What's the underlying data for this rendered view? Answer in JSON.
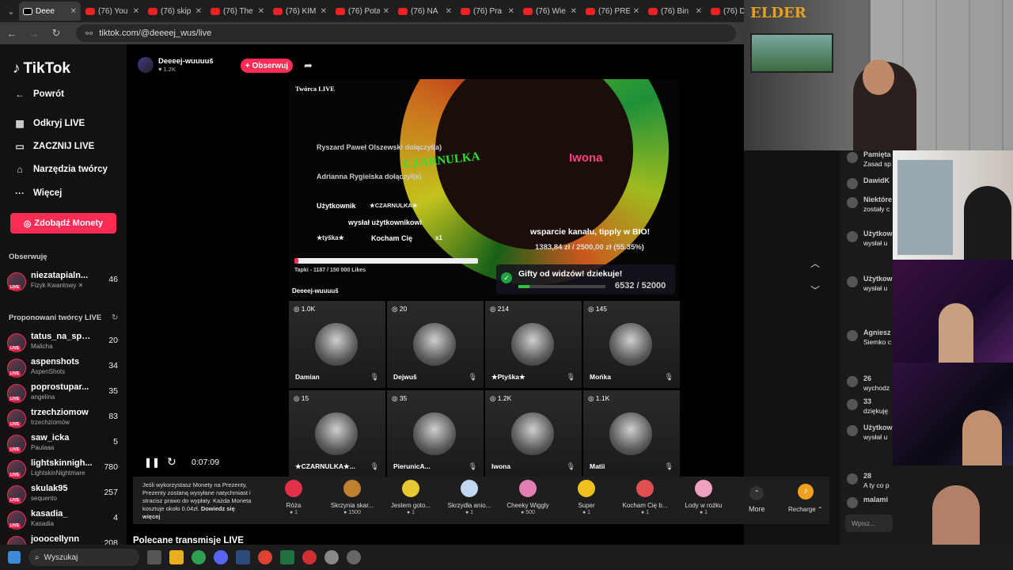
{
  "browser": {
    "tabs": [
      {
        "title": "Deee",
        "active": true
      },
      {
        "title": "(76) You"
      },
      {
        "title": "(76) skip"
      },
      {
        "title": "(76) The"
      },
      {
        "title": "(76) KIM"
      },
      {
        "title": "(76) Pota"
      },
      {
        "title": "(76) NA"
      },
      {
        "title": "(76) Pra"
      },
      {
        "title": "(76) Wie"
      },
      {
        "title": "(76) PRE"
      },
      {
        "title": "(76) Bin"
      },
      {
        "title": "(76) D"
      }
    ],
    "url": "tiktok.com/@deeeej_wus/live"
  },
  "sidebar": {
    "logo": "TikTok",
    "nav": [
      {
        "label": "Powrót",
        "icon": "back-arrow-icon",
        "glyph": "←"
      },
      {
        "label": "Odkryj LIVE",
        "icon": "calendar-icon",
        "glyph": "▦"
      },
      {
        "label": "ZACZNIJ LIVE",
        "icon": "camera-icon",
        "glyph": "▭"
      },
      {
        "label": "Narzędzia twórcy",
        "icon": "home-icon",
        "glyph": "⌂"
      },
      {
        "label": "Więcej",
        "icon": "more-dots-icon",
        "glyph": "···"
      }
    ],
    "coins_button": "Zdobądź Monety",
    "following_title": "Obserwuję",
    "following": [
      {
        "name": "niezatapialn...",
        "sub": "Fizyk Kwantowy ✕",
        "count": "46"
      }
    ],
    "suggested_title": "Proponowani twórcy LIVE",
    "suggested": [
      {
        "name": "tatus_na_spo...",
        "sub": "Malicha",
        "count": "20"
      },
      {
        "name": "aspenshots",
        "sub": "AspenShots",
        "count": "34"
      },
      {
        "name": "poprostupar...",
        "sub": "angelina",
        "count": "35"
      },
      {
        "name": "trzechziomow",
        "sub": "trzechziomów",
        "count": "83"
      },
      {
        "name": "saw_icka",
        "sub": "Paulaaa",
        "count": "5"
      },
      {
        "name": "lightskinnigh...",
        "sub": "LightskinNightmare",
        "count": "780"
      },
      {
        "name": "skulak95",
        "sub": "sequento",
        "count": "257"
      },
      {
        "name": "kasadia_",
        "sub": "Kasadia",
        "count": "4"
      },
      {
        "name": "jooocellynn",
        "sub": "",
        "count": "208"
      }
    ]
  },
  "host": {
    "name": "Deeeej-wuuuuš",
    "followers": "1.2K",
    "follow_label": "+ Obserwuj"
  },
  "stream": {
    "creator_tag": "Twórca LIVE",
    "joins": [
      {
        "name": "Ryszard Paweł Olszewski",
        "action": "dołączył(a)"
      },
      {
        "name": "Adrianna Rygielska",
        "action": "dołączył(a)"
      }
    ],
    "banner": "CZARNULKA",
    "gift_user": "Użytkownik",
    "gift_from": "★CZARNULKA★",
    "gift_action": "wysłał użytkownikowi",
    "gift_target": "★tyška★",
    "gift_msg": "Kocham Cię",
    "gift_mult": "x1",
    "iwona": "Iwona",
    "support_text": "wsparcie kanału, tipply w BIO!",
    "money": "1383,84 zł / 2500,00 zł (55.35%)",
    "likes_text": "Tapki - 1187 / 150 000 Likes",
    "likes_progress": 0.0079,
    "goal_text": "Gifty od widzów! dziekuje!",
    "goal_current": "6532",
    "goal_total": "52000",
    "goal_progress": 0.1256,
    "host_label": "Deeeej-wuuuuš"
  },
  "guests": [
    {
      "count": "1.0K",
      "name": "Damian"
    },
    {
      "count": "20",
      "name": "Dejwuš"
    },
    {
      "count": "214",
      "name": "★Ptyška★"
    },
    {
      "count": "145",
      "name": "Mońka"
    },
    {
      "count": "15",
      "name": "★CZARNULKA★..."
    },
    {
      "count": "35",
      "name": "PierunicA..."
    },
    {
      "count": "1.2K",
      "name": "Iwona"
    },
    {
      "count": "1.1K",
      "name": "Matii"
    }
  ],
  "player": {
    "time": "0:07:09"
  },
  "gifts": {
    "info": "Jeśli wykorzystasz Monety na Prezenty, Prezenty zostaną wysyłane natychmiast i stracisz prawo do wypłaty. Każda Moneta kosztuje około 0.04zł.",
    "info_link": "Dowiedz się więcej",
    "items": [
      {
        "label": "Róża",
        "price": "1",
        "color": "#e0304a"
      },
      {
        "label": "Skrzynia skar...",
        "price": "1500",
        "color": "#c08030"
      },
      {
        "label": "Jestem goto...",
        "price": "1",
        "color": "#e8c830"
      },
      {
        "label": "Skrzydła anio...",
        "price": "1",
        "color": "#c0d8f0"
      },
      {
        "label": "Cheeky Wiggly",
        "price": "500",
        "color": "#e080b0"
      },
      {
        "label": "Super",
        "price": "1",
        "color": "#f0c020"
      },
      {
        "label": "Kocham Cię b...",
        "price": "1",
        "color": "#e05050"
      },
      {
        "label": "Lody w rożku",
        "price": "1",
        "color": "#f0a0c0"
      }
    ],
    "more": "More",
    "recharge": "Recharge"
  },
  "recommended": "Polecane transmisje LIVE",
  "chat": {
    "messages": [
      {
        "name": "Pamięta",
        "text": "Zasad sp"
      },
      {
        "name": "DawidK",
        "text": ""
      },
      {
        "name": "Niektóre",
        "text": "zostały c"
      },
      {
        "name": "Użytkow",
        "text": "wysłał u"
      },
      {
        "name": "Użytkow",
        "text": "wysłał u"
      },
      {
        "name": "Agniesz",
        "text": "Siemko c"
      },
      {
        "name": "26",
        "text": "wychodz"
      },
      {
        "name": "33",
        "text": "dziękuję"
      },
      {
        "name": "Użytkow",
        "text": "wysłał u"
      },
      {
        "name": "28",
        "text": "A ty co p"
      },
      {
        "name": "malami",
        "text": ""
      }
    ],
    "input_placeholder": "Wpisz..."
  },
  "webcam": {
    "logo": "ELDER"
  },
  "taskbar": {
    "search": "Wyszukaj"
  }
}
